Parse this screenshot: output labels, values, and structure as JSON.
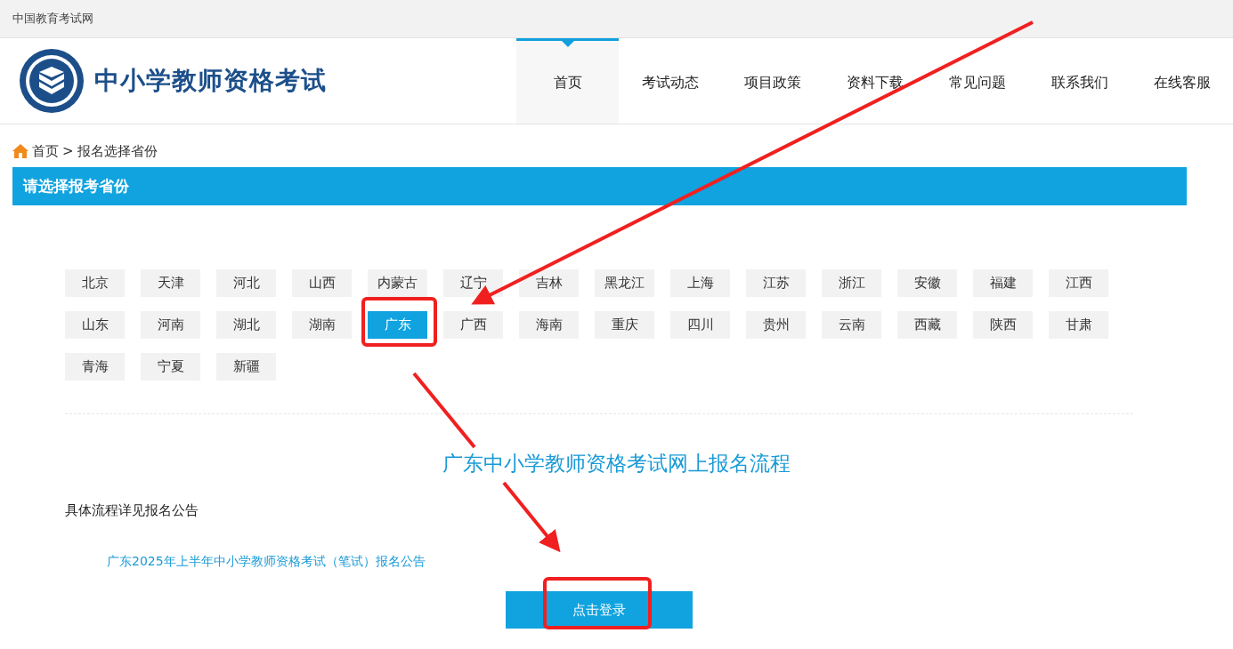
{
  "top_bar": {
    "site_name": "中国教育考试网"
  },
  "header": {
    "logo_text": "中小学教师资格考试",
    "nav": [
      {
        "label": "首页",
        "selected": true
      },
      {
        "label": "考试动态",
        "selected": false
      },
      {
        "label": "项目政策",
        "selected": false
      },
      {
        "label": "资料下载",
        "selected": false
      },
      {
        "label": "常见问题",
        "selected": false
      },
      {
        "label": "联系我们",
        "selected": false
      },
      {
        "label": "在线客服",
        "selected": false
      }
    ]
  },
  "breadcrumb": {
    "home": "首页",
    "separator": ">",
    "current": "报名选择省份"
  },
  "section_title": "请选择报考省份",
  "provinces": [
    {
      "label": "北京",
      "selected": false
    },
    {
      "label": "天津",
      "selected": false
    },
    {
      "label": "河北",
      "selected": false
    },
    {
      "label": "山西",
      "selected": false
    },
    {
      "label": "内蒙古",
      "selected": false
    },
    {
      "label": "辽宁",
      "selected": false
    },
    {
      "label": "吉林",
      "selected": false
    },
    {
      "label": "黑龙江",
      "selected": false
    },
    {
      "label": "上海",
      "selected": false
    },
    {
      "label": "江苏",
      "selected": false
    },
    {
      "label": "浙江",
      "selected": false
    },
    {
      "label": "安徽",
      "selected": false
    },
    {
      "label": "福建",
      "selected": false
    },
    {
      "label": "江西",
      "selected": false
    },
    {
      "label": "山东",
      "selected": false
    },
    {
      "label": "河南",
      "selected": false
    },
    {
      "label": "湖北",
      "selected": false
    },
    {
      "label": "湖南",
      "selected": false
    },
    {
      "label": "广东",
      "selected": true
    },
    {
      "label": "广西",
      "selected": false
    },
    {
      "label": "海南",
      "selected": false
    },
    {
      "label": "重庆",
      "selected": false
    },
    {
      "label": "四川",
      "selected": false
    },
    {
      "label": "贵州",
      "selected": false
    },
    {
      "label": "云南",
      "selected": false
    },
    {
      "label": "西藏",
      "selected": false
    },
    {
      "label": "陕西",
      "selected": false
    },
    {
      "label": "甘肃",
      "selected": false
    },
    {
      "label": "青海",
      "selected": false
    },
    {
      "label": "宁夏",
      "selected": false
    },
    {
      "label": "新疆",
      "selected": false
    }
  ],
  "process": {
    "title": "广东中小学教师资格考试网上报名流程",
    "note": "具体流程详见报名公告",
    "link": "广东2025年上半年中小学教师资格考试（笔试）报名公告",
    "button": "点击登录"
  }
}
